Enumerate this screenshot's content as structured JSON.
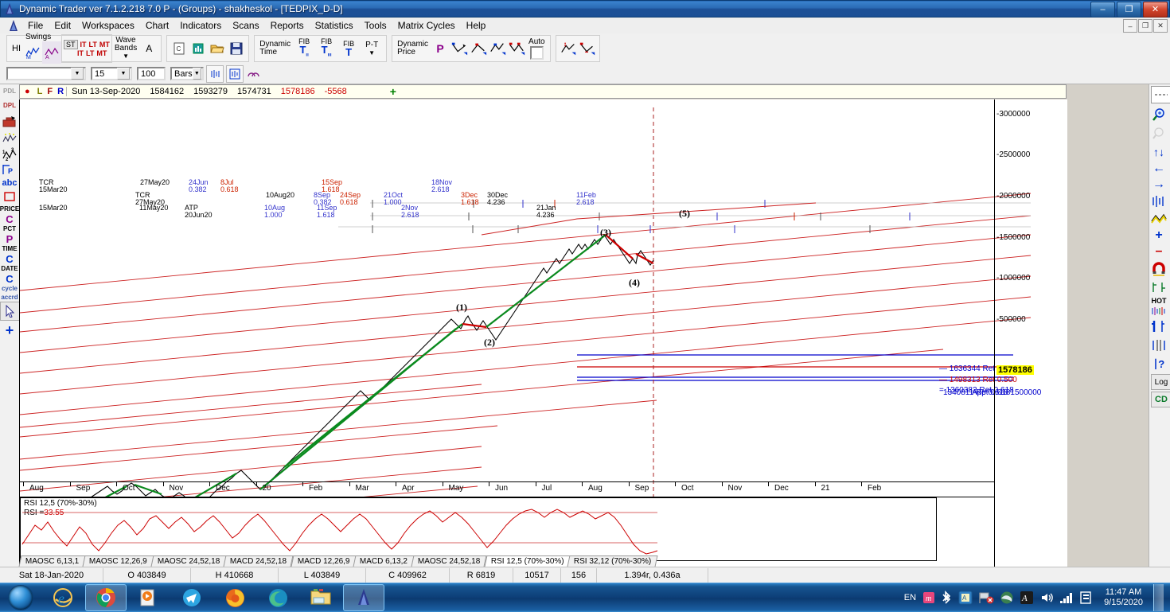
{
  "window": {
    "title": "Dynamic Trader ver 7.1.2.218 7.0 P - (Groups) - shakheskol - [TEDPIX_D-D]",
    "minimize": "–",
    "maximize": "❐",
    "close": "✕",
    "inner_minimize": "–",
    "inner_restore": "❐",
    "inner_close": "✕"
  },
  "menu": {
    "items": [
      "File",
      "Edit",
      "Workspaces",
      "Chart",
      "Indicators",
      "Scans",
      "Reports",
      "Statistics",
      "Tools",
      "Matrix Cycles",
      "Help"
    ]
  },
  "toolbar": {
    "hi": "HI",
    "swings": "Swings",
    "swing_st": "ST",
    "swing_it1": "IT",
    "swing_lt1": "LT",
    "swing_mt1": "MT",
    "swing_it2": "IT",
    "swing_lt2": "LT",
    "swing_mt2": "MT",
    "wave": "Wave",
    "bands": "Bands",
    "a_label": "A",
    "new_label": "C",
    "dynamic": "Dynamic",
    "time": "Time",
    "fib1": "FIB",
    "fib2": "FIB",
    "fib3": "FIB",
    "pt": "P-T",
    "dyn_price_1": "Dynamic",
    "dyn_price_2": "Price",
    "p_letter": "P",
    "auto": "Auto"
  },
  "symbolbar": {
    "symbol_value": "",
    "symbol_placeholder": "",
    "period_value": "15",
    "bars_value": "100",
    "unit_value": "Bars"
  },
  "left_toolbar": {
    "items": [
      {
        "name": "pdl",
        "label": "PDL"
      },
      {
        "name": "dpl",
        "label": "DPL"
      },
      {
        "name": "toolbox",
        "label": ""
      },
      {
        "name": "wave-pattern",
        "label": ""
      },
      {
        "name": "wave-count",
        "label": ""
      },
      {
        "name": "pivot-p",
        "label": "P"
      },
      {
        "name": "text-abc",
        "label": "abc"
      },
      {
        "name": "rectangle",
        "label": ""
      },
      {
        "name": "price-c",
        "label": "PRICE"
      },
      {
        "name": "price-c-letter",
        "label": "C"
      },
      {
        "name": "pct-p",
        "label": "PCT"
      },
      {
        "name": "pct-p-letter",
        "label": "P"
      },
      {
        "name": "time-c",
        "label": "TIME"
      },
      {
        "name": "time-c-letter",
        "label": "C"
      },
      {
        "name": "date-c",
        "label": "DATE"
      },
      {
        "name": "date-c-letter",
        "label": "C"
      },
      {
        "name": "cycle",
        "label": "cycle"
      },
      {
        "name": "accrd",
        "label": "accrd"
      },
      {
        "name": "cursor",
        "label": ""
      },
      {
        "name": "crosshair",
        "label": ""
      }
    ]
  },
  "right_toolbar": {
    "items": [
      {
        "name": "dashed-line",
        "label": ""
      },
      {
        "name": "zoom-in-icon",
        "label": ""
      },
      {
        "name": "zoom-out-icon",
        "label": ""
      },
      {
        "name": "scale-updown-icon",
        "label": "↑↓"
      },
      {
        "name": "pan-left-icon",
        "label": "←"
      },
      {
        "name": "pan-right-icon",
        "label": "→"
      },
      {
        "name": "bars-icon",
        "label": ""
      },
      {
        "name": "line-chart-icon",
        "label": ""
      },
      {
        "name": "plus-icon",
        "label": "+"
      },
      {
        "name": "minus-icon",
        "label": "–"
      },
      {
        "name": "magnet-icon",
        "label": ""
      },
      {
        "name": "bar-spacing-icon",
        "label": ""
      },
      {
        "name": "hot-icon",
        "label": "HOT"
      },
      {
        "name": "single-bar-icon",
        "label": ""
      },
      {
        "name": "multi-bar-icon",
        "label": ""
      },
      {
        "name": "bar-query-icon",
        "label": "?"
      },
      {
        "name": "log-scale-button",
        "label": "Log"
      },
      {
        "name": "cd-button",
        "label": "CD"
      }
    ]
  },
  "datastrip": {
    "markers": [
      "L",
      "F",
      "R"
    ],
    "date": "Sun 13-Sep-2020",
    "open": "1584162",
    "high": "1593279",
    "low": "1574731",
    "close": "1578186",
    "change": "-5568",
    "plus": "+"
  },
  "chart_data": {
    "type": "line",
    "title": "TEDPIX_D-D",
    "xlabel": "",
    "ylabel": "",
    "grid": false,
    "legend": "none",
    "ylim": [
      300000,
      3200000
    ],
    "price_ticks": [
      "3000000",
      "2500000",
      "2000000",
      "1500000",
      "1000000",
      "500000"
    ],
    "price_tick_values": [
      3000000,
      2500000,
      2000000,
      1500000,
      1000000,
      500000
    ],
    "current_price_label": "1578186",
    "time_ticks": [
      "Aug",
      "Sep",
      "Oct",
      "Nov",
      "Dec",
      "20",
      "Feb",
      "Mar",
      "Apr",
      "May",
      "Jun",
      "Jul",
      "Aug",
      "Sep",
      "Oct",
      "Nov",
      "Dec",
      "21",
      "Feb"
    ],
    "wave_labels": [
      {
        "text": "(1)",
        "x": 572,
        "y": 390
      },
      {
        "text": "(2)",
        "x": 607,
        "y": 434
      },
      {
        "text": "(3)",
        "x": 753,
        "y": 296
      },
      {
        "text": "(4)",
        "x": 789,
        "y": 359
      },
      {
        "text": "(5)",
        "x": 852,
        "y": 272
      }
    ],
    "retracements": [
      {
        "price": "1636344",
        "label": "Ret 0.382",
        "color": "#0000cc"
      },
      {
        "price": "1498313",
        "label": "Ret 0.500",
        "color": "#cc0000"
      },
      {
        "price": "1360382",
        "label": "Ret 0.618",
        "color": "#0000cc"
      },
      {
        "price": "1340811",
        "label": "Ret 0.618",
        "color": "#0000cc"
      },
      {
        "price": "1500000",
        "label": "App 0.618",
        "color": "#0000cc"
      }
    ],
    "time_projections_row1": [
      {
        "date": "TCR",
        "ratio": "15Mar20",
        "x": 465,
        "color": "#000000"
      },
      {
        "date": "27May20",
        "ratio": "",
        "x": 592,
        "color": "#000000"
      },
      {
        "date": "24Jun",
        "ratio": "0.382",
        "x": 653,
        "color": "#3333cc"
      },
      {
        "date": "8Jul",
        "ratio": "0.618",
        "x": 693,
        "color": "#cc2200"
      },
      {
        "date": "15Sep",
        "ratio": "1.618",
        "x": 820,
        "color": "#cc2200"
      },
      {
        "date": "18Nov",
        "ratio": "2.618",
        "x": 958,
        "color": "#3333cc"
      }
    ],
    "time_projections_row2": [
      {
        "date": "TCR",
        "ratio": "27May20",
        "x": 586,
        "color": "#000000"
      },
      {
        "date": "10Aug20",
        "ratio": "",
        "x": 750,
        "color": "#000000"
      },
      {
        "date": "8Sep",
        "ratio": "0.382",
        "x": 810,
        "color": "#3333cc"
      },
      {
        "date": "24Sep",
        "ratio": "0.618",
        "x": 843,
        "color": "#cc2200"
      },
      {
        "date": "21Oct",
        "ratio": "1.000",
        "x": 898,
        "color": "#3333cc"
      },
      {
        "date": "3Dec",
        "ratio": "1.618",
        "x": 995,
        "color": "#cc2200"
      },
      {
        "date": "30Dec",
        "ratio": "4.236",
        "x": 1028,
        "color": "#000000"
      },
      {
        "date": "11Feb",
        "ratio": "2.618",
        "x": 1140,
        "color": "#3333cc"
      }
    ],
    "time_projections_row3": [
      {
        "date": "15Mar20",
        "ratio": "",
        "x": 465,
        "color": "#000000"
      },
      {
        "date": "11May20",
        "ratio": "",
        "x": 591,
        "color": "#000000"
      },
      {
        "date": "ATP",
        "ratio": "20Jun20",
        "x": 648,
        "color": "#000000"
      },
      {
        "date": "10Aug",
        "ratio": "1.000",
        "x": 748,
        "color": "#3333cc"
      },
      {
        "date": "11Sep",
        "ratio": "1.618",
        "x": 814,
        "color": "#3333cc"
      },
      {
        "date": "2Nov",
        "ratio": "2.618",
        "x": 920,
        "color": "#3333cc"
      },
      {
        "date": "21Jan",
        "ratio": "4.236",
        "x": 1090,
        "color": "#000000"
      }
    ]
  },
  "rsi_panel": {
    "title": "RSI 12,5 (70%-30%)",
    "value_label": "RSI =",
    "value": "33.55"
  },
  "indicator_tabs": [
    {
      "label": "MAOSC 6,13,1",
      "active": false
    },
    {
      "label": "MAOSC 12,26,9",
      "active": false
    },
    {
      "label": "MAOSC 24,52,18",
      "active": false
    },
    {
      "label": "MACD 24,52,18",
      "active": false
    },
    {
      "label": "MACD 12,26,9",
      "active": false
    },
    {
      "label": "MACD 6,13,2",
      "active": false
    },
    {
      "label": "MAOSC 24,52,18",
      "active": false
    },
    {
      "label": "RSI 12,5 (70%-30%)",
      "active": true
    },
    {
      "label": "RSI 32,12 (70%-30%)",
      "active": false
    }
  ],
  "statusbar": {
    "cells": [
      "Sat 18-Jan-2020",
      "O 403849",
      "H 410668",
      "L 403849",
      "C 409962",
      "R 6819",
      "10517",
      "156",
      "1.394r, 0.436a"
    ]
  },
  "taskbar": {
    "apps": [
      {
        "name": "internet-explorer",
        "label": ""
      },
      {
        "name": "google-chrome",
        "label": ""
      },
      {
        "name": "media-player",
        "label": ""
      },
      {
        "name": "telegram",
        "label": ""
      },
      {
        "name": "firefox",
        "label": ""
      },
      {
        "name": "microsoft-edge",
        "label": ""
      },
      {
        "name": "file-explorer",
        "label": ""
      },
      {
        "name": "dynamic-trader",
        "label": ""
      }
    ],
    "language": "EN",
    "time": "11:47 AM",
    "date": "9/15/2020"
  }
}
